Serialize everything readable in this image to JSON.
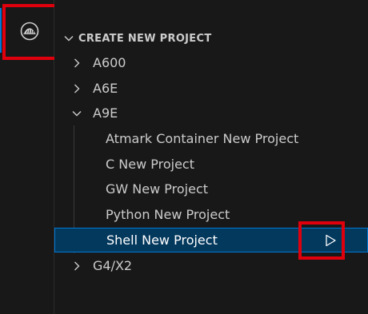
{
  "activity_bar": {
    "active_item_icon": "armadillo-logo-icon"
  },
  "section": {
    "title": "CREATE NEW PROJECT"
  },
  "tree": {
    "groups": [
      {
        "label": "A600",
        "expanded": false
      },
      {
        "label": "A6E",
        "expanded": false
      },
      {
        "label": "A9E",
        "expanded": true
      },
      {
        "label": "G4/X2",
        "expanded": false
      }
    ],
    "a9e_children": [
      {
        "label": "Atmark Container New Project"
      },
      {
        "label": "C New Project"
      },
      {
        "label": "GW New Project"
      },
      {
        "label": "Python New Project"
      },
      {
        "label": "Shell New Project",
        "selected": true
      }
    ]
  },
  "colors": {
    "highlight": "#e0000d",
    "selection_bg": "#04395e",
    "selection_border": "#0078d4",
    "text": "#cccccc",
    "background": "#181818"
  },
  "icons": {
    "collapsed_chevron": "chevron-right-icon",
    "expanded_chevron": "chevron-down-icon",
    "run": "play-icon"
  }
}
